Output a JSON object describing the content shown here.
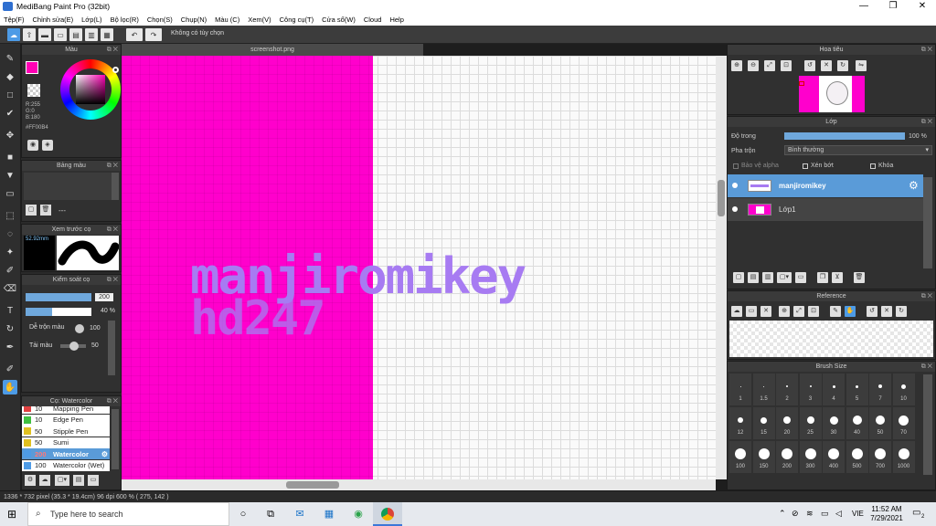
{
  "window": {
    "title": "MediBang Paint Pro (32bit)",
    "minimize": "—",
    "maximize": "❐",
    "close": "✕"
  },
  "menu": [
    "Tệp(F)",
    "Chỉnh sửa(E)",
    "Lớp(L)",
    "Bộ lọc(R)",
    "Chọn(S)",
    "Chụp(N)",
    "Màu (C)",
    "Xem(V)",
    "Công cụ(T)",
    "Cửa sổ(W)",
    "Cloud",
    "Help"
  ],
  "toolbar": {
    "option_label": "Không có tùy chọn"
  },
  "color_panel": {
    "title": "Màu",
    "r": "R:255",
    "g": "G:0",
    "b": "B:180",
    "hex": "#FF00B4",
    "fg_color": "#ff00b4"
  },
  "palette_panel": {
    "title": "Bảng màu",
    "dash": "---"
  },
  "brush_preview": {
    "title": "Xem trước cọ",
    "size": "52.92mm"
  },
  "brush_control": {
    "title": "Kiểm soát cọ",
    "size_value": "200",
    "opacity_value": "40 %",
    "blend_label": "Dễ trộn màu",
    "blend_value": "100",
    "load_label": "Tải màu",
    "load_value": "50",
    "opacity_level": 0.4
  },
  "brush_list": {
    "title": "Cọ: Watercolor",
    "items": [
      {
        "size": "10",
        "name": "Mapping Pen",
        "color": "#e04040"
      },
      {
        "size": "10",
        "name": "Edge Pen",
        "color": "#40c040"
      },
      {
        "size": "50",
        "name": "Stipple Pen",
        "color": "#e0c020"
      },
      {
        "size": "50",
        "name": "Sumi",
        "color": "#e0c020"
      },
      {
        "size": "200",
        "name": "Watercolor",
        "color": "#4d9be6"
      },
      {
        "size": "100",
        "name": "Watercolor (Wet)",
        "color": "#4d9be6"
      }
    ]
  },
  "document": {
    "tab": "screenshot.png",
    "text_line1": "manjiromikey",
    "text_line2": "hd247"
  },
  "navigator": {
    "title": "Hoa tiêu"
  },
  "layers": {
    "title": "Lớp",
    "opacity_label": "Độ trong",
    "opacity_value": "100 %",
    "blend_label": "Pha trộn",
    "blend_value": "Bình thường",
    "protect_alpha": "Bảo vệ alpha",
    "clipping": "Xén bớt",
    "lock": "Khóa",
    "items": [
      {
        "name": "manjiromikey"
      },
      {
        "name": "Lớp1"
      }
    ]
  },
  "reference": {
    "title": "Reference"
  },
  "brush_size": {
    "title": "Brush Size",
    "sizes": [
      "1",
      "1.5",
      "2",
      "3",
      "4",
      "5",
      "7",
      "10",
      "12",
      "15",
      "20",
      "25",
      "30",
      "40",
      "50",
      "70",
      "100",
      "150",
      "200",
      "300",
      "400",
      "500",
      "700",
      "1000"
    ]
  },
  "status": {
    "text": "1336 * 732 pixel  (35.3 * 19.4cm)  96 dpi  600 %  ( 275, 142 )"
  },
  "taskbar": {
    "search_placeholder": "Type here to search",
    "time": "11:52 AM",
    "date": "7/29/2021",
    "lang": "VIE",
    "notif_count": "2"
  }
}
